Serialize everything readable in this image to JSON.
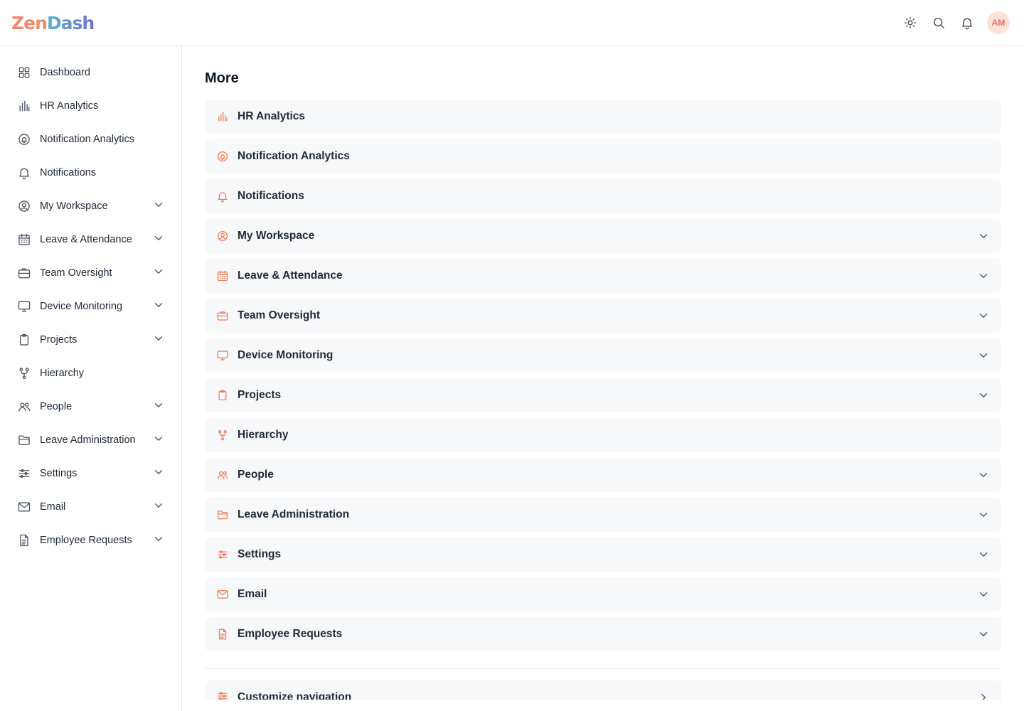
{
  "app": {
    "logo_part1": "Zen",
    "logo_part2": "Dash"
  },
  "header": {
    "user_initials": "AM",
    "icons": [
      "sun-icon",
      "search-icon",
      "bell-icon"
    ]
  },
  "sidebar": {
    "items": [
      {
        "label": "Dashboard",
        "icon": "grid-icon",
        "expandable": false
      },
      {
        "label": "HR Analytics",
        "icon": "bar-chart-icon",
        "expandable": false
      },
      {
        "label": "Notification Analytics",
        "icon": "bell-circle-icon",
        "expandable": false
      },
      {
        "label": "Notifications",
        "icon": "bell-icon",
        "expandable": false
      },
      {
        "label": "My Workspace",
        "icon": "user-circle-icon",
        "expandable": true
      },
      {
        "label": "Leave & Attendance",
        "icon": "calendar-icon",
        "expandable": true
      },
      {
        "label": "Team Oversight",
        "icon": "briefcase-icon",
        "expandable": true
      },
      {
        "label": "Device Monitoring",
        "icon": "monitor-icon",
        "expandable": true
      },
      {
        "label": "Projects",
        "icon": "clipboard-icon",
        "expandable": true
      },
      {
        "label": "Hierarchy",
        "icon": "branch-icon",
        "expandable": false
      },
      {
        "label": "People",
        "icon": "users-icon",
        "expandable": true
      },
      {
        "label": "Leave Administration",
        "icon": "folder-icon",
        "expandable": true
      },
      {
        "label": "Settings",
        "icon": "sliders-icon",
        "expandable": true
      },
      {
        "label": "Email",
        "icon": "mail-icon",
        "expandable": true
      },
      {
        "label": "Employee Requests",
        "icon": "document-icon",
        "expandable": true
      }
    ]
  },
  "main": {
    "title": "More",
    "items": [
      {
        "label": "HR Analytics",
        "icon": "bar-chart-icon",
        "expandable": false
      },
      {
        "label": "Notification Analytics",
        "icon": "bell-circle-icon",
        "expandable": false
      },
      {
        "label": "Notifications",
        "icon": "bell-icon",
        "expandable": false
      },
      {
        "label": "My Workspace",
        "icon": "user-circle-icon",
        "expandable": true
      },
      {
        "label": "Leave & Attendance",
        "icon": "calendar-icon",
        "expandable": true
      },
      {
        "label": "Team Oversight",
        "icon": "briefcase-icon",
        "expandable": true
      },
      {
        "label": "Device Monitoring",
        "icon": "monitor-icon",
        "expandable": true
      },
      {
        "label": "Projects",
        "icon": "clipboard-icon",
        "expandable": true
      },
      {
        "label": "Hierarchy",
        "icon": "branch-icon",
        "expandable": false
      },
      {
        "label": "People",
        "icon": "users-icon",
        "expandable": true
      },
      {
        "label": "Leave Administration",
        "icon": "folder-icon",
        "expandable": true
      },
      {
        "label": "Settings",
        "icon": "sliders-icon",
        "expandable": true
      },
      {
        "label": "Email",
        "icon": "mail-icon",
        "expandable": true
      },
      {
        "label": "Employee Requests",
        "icon": "document-icon",
        "expandable": true
      }
    ],
    "customize_label": "Customize navigation"
  },
  "colors": {
    "accent": "#f07a5a",
    "item_bg": "#f7f8f9",
    "border": "#e5e7eb"
  }
}
